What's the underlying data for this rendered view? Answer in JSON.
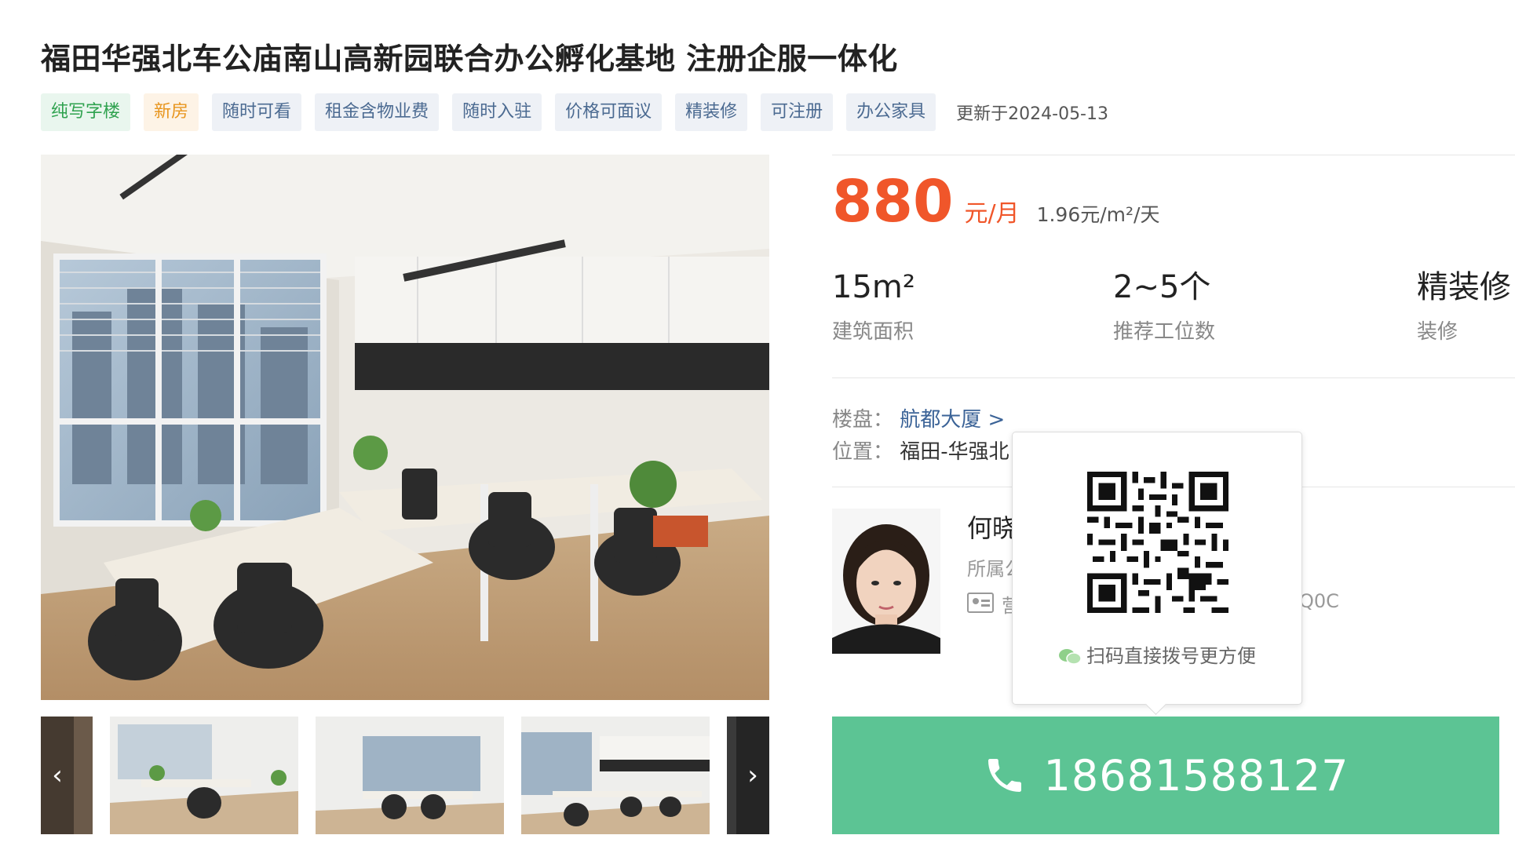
{
  "listing": {
    "title": "福田华强北车公庙南山高新园联合办公孵化基地 注册企服一体化",
    "tags": [
      {
        "label": "纯写字楼",
        "style": "green"
      },
      {
        "label": "新房",
        "style": "orange"
      },
      {
        "label": "随时可看",
        "style": "blue"
      },
      {
        "label": "租金含物业费",
        "style": "blue"
      },
      {
        "label": "随时入驻",
        "style": "blue"
      },
      {
        "label": "价格可面议",
        "style": "blue"
      },
      {
        "label": "精装修",
        "style": "blue"
      },
      {
        "label": "可注册",
        "style": "blue"
      },
      {
        "label": "办公家具",
        "style": "blue"
      }
    ],
    "updated": "更新于2024-05-13"
  },
  "price": {
    "value": "880",
    "unit": "元/月",
    "per_area": "1.96元/m²/天"
  },
  "specs": [
    {
      "value": "15m²",
      "label": "建筑面积"
    },
    {
      "value": "2~5个",
      "label": "推荐工位数"
    },
    {
      "value": "精装修",
      "label": "装修"
    }
  ],
  "info": {
    "building_key": "楼盘：",
    "building_value": "航都大厦 >",
    "location_key": "位置：",
    "location_value": "福田-华强北"
  },
  "agent": {
    "name": "何晓",
    "company": "所属公",
    "license_prefix": "营",
    "license_suffix": "Q0C"
  },
  "qr_popup": {
    "caption": "扫码直接拨号更方便"
  },
  "contact": {
    "phone": "18681588127"
  },
  "gallery": {
    "prev_icon": "chevron-left-icon",
    "next_icon": "chevron-right-icon",
    "prev_glyph": "‹",
    "next_glyph": "›"
  }
}
